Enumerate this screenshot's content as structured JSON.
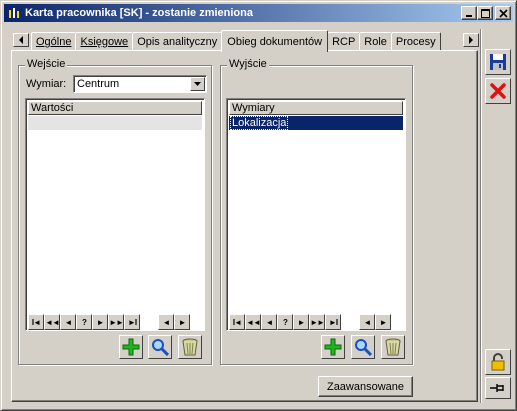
{
  "window": {
    "title": "Karta pracownika [SK] - zostanie zmieniona"
  },
  "tabs": [
    {
      "label": "Ogólne",
      "active": false
    },
    {
      "label": "Księgowe",
      "active": false
    },
    {
      "label": "Opis analityczny",
      "active": false
    },
    {
      "label": "Obieg dokumentów",
      "active": true
    },
    {
      "label": "RCP",
      "active": false
    },
    {
      "label": "Role",
      "active": false
    },
    {
      "label": "Procesy",
      "active": false
    }
  ],
  "input_group": {
    "label": "Wejście",
    "dimension_label": "Wymiar:",
    "dimension_value": "Centrum",
    "list_header": "Wartości",
    "rows": []
  },
  "output_group": {
    "label": "Wyjście",
    "list_header": "Wymiary",
    "rows": [
      {
        "label": "Lokalizacja",
        "selected": true
      }
    ]
  },
  "navigation": {
    "first": "I◄",
    "prev_page": "◄◄",
    "prev": "◄",
    "help": "?",
    "next": "►",
    "next_page": "►►",
    "last": "►I",
    "scroll_left": "◄",
    "scroll_right": "►"
  },
  "advanced_button": "Zaawansowane",
  "icons": {
    "add": "plus-icon",
    "search": "magnifier-icon",
    "delete": "trash-icon",
    "save": "floppy-icon",
    "cancel": "red-x-icon",
    "lock": "padlock-icon",
    "pin": "pin-icon"
  },
  "colors": {
    "titlebar_start": "#0a246a",
    "titlebar_end": "#a6caf0",
    "selection": "#0a246a",
    "face": "#d4d0c8"
  }
}
